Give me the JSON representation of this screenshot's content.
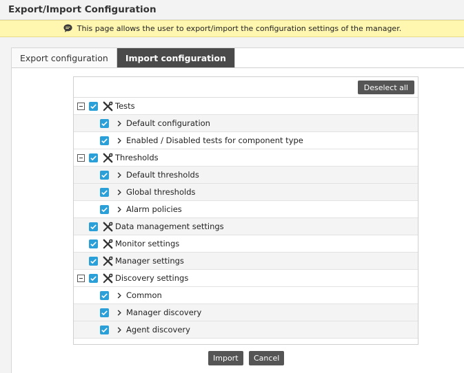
{
  "page": {
    "title": "Export/Import Configuration",
    "info_text": "This page allows the user to export/import the configuration settings of the manager."
  },
  "tabs": [
    {
      "label": "Export configuration",
      "active": false
    },
    {
      "label": "Import configuration",
      "active": true
    }
  ],
  "toolbar": {
    "deselect_all_label": "Deselect all"
  },
  "tree": {
    "tests": {
      "label": "Tests",
      "checked": true,
      "children": [
        {
          "label": "Default configuration",
          "checked": true
        },
        {
          "label": "Enabled / Disabled tests for component type",
          "checked": true
        }
      ]
    },
    "thresholds": {
      "label": "Thresholds",
      "checked": true,
      "children": [
        {
          "label": "Default thresholds",
          "checked": true
        },
        {
          "label": "Global thresholds",
          "checked": true
        },
        {
          "label": "Alarm policies",
          "checked": true
        }
      ]
    },
    "data_management": {
      "label": "Data management settings",
      "checked": true
    },
    "monitor": {
      "label": "Monitor settings",
      "checked": true
    },
    "manager": {
      "label": "Manager settings",
      "checked": true
    },
    "discovery": {
      "label": "Discovery settings",
      "checked": true,
      "children": [
        {
          "label": "Common",
          "checked": true
        },
        {
          "label": "Manager discovery",
          "checked": true
        },
        {
          "label": "Agent discovery",
          "checked": true
        }
      ]
    }
  },
  "actions": {
    "import_label": "Import",
    "cancel_label": "Cancel"
  },
  "colors": {
    "checkbox": "#2a9fd8",
    "button": "#555555",
    "banner": "#fff7b0",
    "active_tab": "#4a4a4a"
  }
}
